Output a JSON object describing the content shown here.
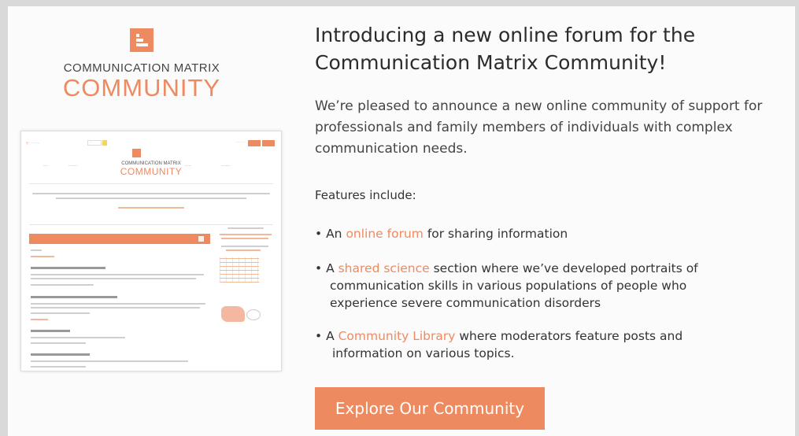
{
  "logo": {
    "title": "COMMUNICATION MATRIX",
    "subtitle": "COMMUNITY"
  },
  "headline": "Introducing a new online forum for the Communication Matrix Community!",
  "intro": "We’re pleased to announce a new online community of support for professionals and family members of individuals with complex communication needs.",
  "features_label": "Features include:",
  "features": [
    {
      "pre": "An ",
      "link": "online forum",
      "post": " for sharing information"
    },
    {
      "pre": "A ",
      "link": "shared science",
      "post": " section where we’ve developed portraits of communication skills in various populations of people who experience severe communication disorders"
    },
    {
      "pre": "A ",
      "link": "Community Library",
      "post": " where moderators feature posts and information on various topics."
    }
  ],
  "cta_label": "Explore Our Community",
  "preview": {
    "logo_title": "COMMUNICATION MATRIX",
    "logo_subtitle": "COMMUNITY"
  },
  "colors": {
    "accent": "#ee8a5f",
    "text": "#333333",
    "background": "#fbfbfb"
  }
}
